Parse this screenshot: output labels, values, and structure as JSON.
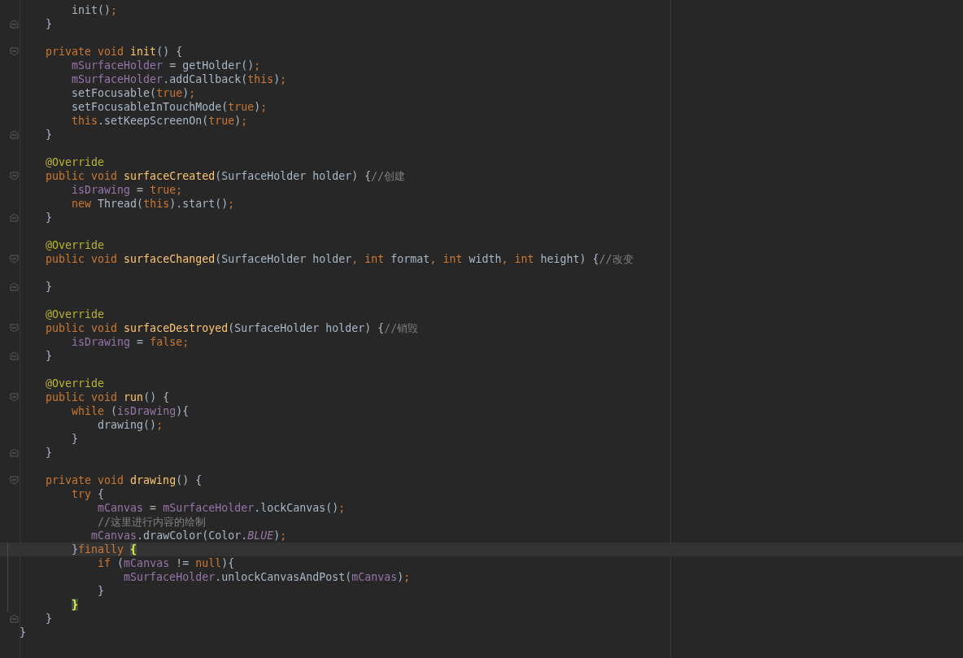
{
  "editor": {
    "lines": [
      {
        "tokens": [
          {
            "kind": "plain",
            "text": "        init()"
          },
          {
            "kind": "keyword",
            "text": ";"
          }
        ]
      },
      {
        "fold_end": true,
        "tokens": [
          {
            "kind": "plain",
            "text": "    }"
          }
        ]
      },
      {
        "blank_before": true,
        "fold_start": true,
        "tokens": [
          {
            "kind": "keyword",
            "text": "    private void "
          },
          {
            "kind": "declaration",
            "text": "init"
          },
          {
            "kind": "plain",
            "text": "() {"
          }
        ]
      },
      {
        "tokens": [
          {
            "kind": "field",
            "text": "        mSurfaceHolder"
          },
          {
            "kind": "plain",
            "text": " = getHolder()"
          },
          {
            "kind": "keyword",
            "text": ";"
          }
        ]
      },
      {
        "tokens": [
          {
            "kind": "field",
            "text": "        mSurfaceHolder"
          },
          {
            "kind": "plain",
            "text": ".addCallback("
          },
          {
            "kind": "keyword",
            "text": "this"
          },
          {
            "kind": "plain",
            "text": ")"
          },
          {
            "kind": "keyword",
            "text": ";"
          }
        ]
      },
      {
        "tokens": [
          {
            "kind": "plain",
            "text": "        setFocusable("
          },
          {
            "kind": "keyword",
            "text": "true"
          },
          {
            "kind": "plain",
            "text": ")"
          },
          {
            "kind": "keyword",
            "text": ";"
          }
        ]
      },
      {
        "tokens": [
          {
            "kind": "plain",
            "text": "        setFocusableInTouchMode("
          },
          {
            "kind": "keyword",
            "text": "true"
          },
          {
            "kind": "plain",
            "text": ")"
          },
          {
            "kind": "keyword",
            "text": ";"
          }
        ]
      },
      {
        "tokens": [
          {
            "kind": "keyword",
            "text": "        this"
          },
          {
            "kind": "plain",
            "text": ".setKeepScreenOn("
          },
          {
            "kind": "keyword",
            "text": "true"
          },
          {
            "kind": "plain",
            "text": ")"
          },
          {
            "kind": "keyword",
            "text": ";"
          }
        ]
      },
      {
        "fold_end": true,
        "tokens": [
          {
            "kind": "plain",
            "text": "    }"
          }
        ]
      },
      {
        "blank_before": true,
        "tokens": [
          {
            "kind": "annotation",
            "text": "    @Override"
          }
        ]
      },
      {
        "fold_start": true,
        "tokens": [
          {
            "kind": "keyword",
            "text": "    public void "
          },
          {
            "kind": "declaration",
            "text": "surfaceCreated"
          },
          {
            "kind": "plain",
            "text": "(SurfaceHolder holder) {"
          },
          {
            "kind": "comment",
            "text": "//创建"
          }
        ]
      },
      {
        "tokens": [
          {
            "kind": "field",
            "text": "        isDrawing"
          },
          {
            "kind": "plain",
            "text": " = "
          },
          {
            "kind": "keyword",
            "text": "true;"
          }
        ]
      },
      {
        "tokens": [
          {
            "kind": "keyword",
            "text": "        new "
          },
          {
            "kind": "plain",
            "text": "Thread("
          },
          {
            "kind": "keyword",
            "text": "this"
          },
          {
            "kind": "plain",
            "text": ").start()"
          },
          {
            "kind": "keyword",
            "text": ";"
          }
        ]
      },
      {
        "fold_end": true,
        "tokens": [
          {
            "kind": "plain",
            "text": "    }"
          }
        ]
      },
      {
        "blank_before": true,
        "tokens": [
          {
            "kind": "annotation",
            "text": "    @Override"
          }
        ]
      },
      {
        "fold_start": true,
        "tokens": [
          {
            "kind": "keyword",
            "text": "    public void "
          },
          {
            "kind": "declaration",
            "text": "surfaceChanged"
          },
          {
            "kind": "plain",
            "text": "(SurfaceHolder holder"
          },
          {
            "kind": "keyword",
            "text": ", int "
          },
          {
            "kind": "plain",
            "text": "format"
          },
          {
            "kind": "keyword",
            "text": ", int "
          },
          {
            "kind": "plain",
            "text": "width"
          },
          {
            "kind": "keyword",
            "text": ", int "
          },
          {
            "kind": "plain",
            "text": "height) {"
          },
          {
            "kind": "comment",
            "text": "//改变"
          }
        ]
      },
      {
        "blank_before": true,
        "fold_end": true,
        "tokens": [
          {
            "kind": "plain",
            "text": "    }"
          }
        ]
      },
      {
        "blank_before": true,
        "tokens": [
          {
            "kind": "annotation",
            "text": "    @Override"
          }
        ]
      },
      {
        "fold_start": true,
        "tokens": [
          {
            "kind": "keyword",
            "text": "    public void "
          },
          {
            "kind": "declaration",
            "text": "surfaceDestroyed"
          },
          {
            "kind": "plain",
            "text": "(SurfaceHolder holder) {"
          },
          {
            "kind": "comment",
            "text": "//销毁"
          }
        ]
      },
      {
        "tokens": [
          {
            "kind": "field",
            "text": "        isDrawing"
          },
          {
            "kind": "plain",
            "text": " = "
          },
          {
            "kind": "keyword",
            "text": "false;"
          }
        ]
      },
      {
        "fold_end": true,
        "tokens": [
          {
            "kind": "plain",
            "text": "    }"
          }
        ]
      },
      {
        "blank_before": true,
        "tokens": [
          {
            "kind": "annotation",
            "text": "    @Override"
          }
        ]
      },
      {
        "fold_start": true,
        "tokens": [
          {
            "kind": "keyword",
            "text": "    public void "
          },
          {
            "kind": "declaration",
            "text": "run"
          },
          {
            "kind": "plain",
            "text": "() {"
          }
        ]
      },
      {
        "tokens": [
          {
            "kind": "keyword",
            "text": "        while "
          },
          {
            "kind": "plain",
            "text": "("
          },
          {
            "kind": "field",
            "text": "isDrawing"
          },
          {
            "kind": "plain",
            "text": "){"
          }
        ]
      },
      {
        "tokens": [
          {
            "kind": "plain",
            "text": "            drawing()"
          },
          {
            "kind": "keyword",
            "text": ";"
          }
        ]
      },
      {
        "tokens": [
          {
            "kind": "plain",
            "text": "        }"
          }
        ]
      },
      {
        "fold_end": true,
        "tokens": [
          {
            "kind": "plain",
            "text": "    }"
          }
        ]
      },
      {
        "blank_before": true,
        "fold_start": true,
        "tokens": [
          {
            "kind": "keyword",
            "text": "    private void "
          },
          {
            "kind": "declaration",
            "text": "drawing"
          },
          {
            "kind": "plain",
            "text": "() {"
          }
        ]
      },
      {
        "tokens": [
          {
            "kind": "keyword",
            "text": "        try "
          },
          {
            "kind": "plain",
            "text": "{"
          }
        ]
      },
      {
        "tokens": [
          {
            "kind": "field",
            "text": "            mCanvas"
          },
          {
            "kind": "plain",
            "text": " = "
          },
          {
            "kind": "field",
            "text": "mSurfaceHolder"
          },
          {
            "kind": "plain",
            "text": ".lockCanvas()"
          },
          {
            "kind": "keyword",
            "text": ";"
          }
        ]
      },
      {
        "tokens": [
          {
            "kind": "comment",
            "text": "            //这里进行内容的绘制"
          }
        ]
      },
      {
        "tokens": [
          {
            "kind": "field",
            "text": "           mCanvas"
          },
          {
            "kind": "plain",
            "text": ".drawColor(Color."
          },
          {
            "kind": "constant",
            "text": "BLUE"
          },
          {
            "kind": "plain",
            "text": ")"
          },
          {
            "kind": "keyword",
            "text": ";"
          }
        ]
      },
      {
        "current": true,
        "changed": true,
        "tokens": [
          {
            "kind": "plain",
            "text": "        }"
          },
          {
            "kind": "keyword",
            "text": "finally "
          },
          {
            "kind": "match",
            "text": "{"
          }
        ]
      },
      {
        "changed": true,
        "tokens": [
          {
            "kind": "keyword",
            "text": "            if "
          },
          {
            "kind": "plain",
            "text": "("
          },
          {
            "kind": "field",
            "text": "mCanvas"
          },
          {
            "kind": "plain",
            "text": " != "
          },
          {
            "kind": "keyword",
            "text": "null"
          },
          {
            "kind": "plain",
            "text": "){"
          }
        ]
      },
      {
        "changed": true,
        "tokens": [
          {
            "kind": "field",
            "text": "                mSurfaceHolder"
          },
          {
            "kind": "plain",
            "text": ".unlockCanvasAndPost("
          },
          {
            "kind": "field",
            "text": "mCanvas"
          },
          {
            "kind": "plain",
            "text": ")"
          },
          {
            "kind": "keyword",
            "text": ";"
          }
        ]
      },
      {
        "changed": true,
        "tokens": [
          {
            "kind": "plain",
            "text": "            }"
          }
        ]
      },
      {
        "changed": true,
        "tokens": [
          {
            "kind": "match",
            "text": "        }"
          }
        ]
      },
      {
        "fold_end": true,
        "tokens": [
          {
            "kind": "plain",
            "text": "    }"
          }
        ]
      },
      {
        "tokens": [
          {
            "kind": "plain",
            "text": "}"
          }
        ]
      }
    ]
  }
}
